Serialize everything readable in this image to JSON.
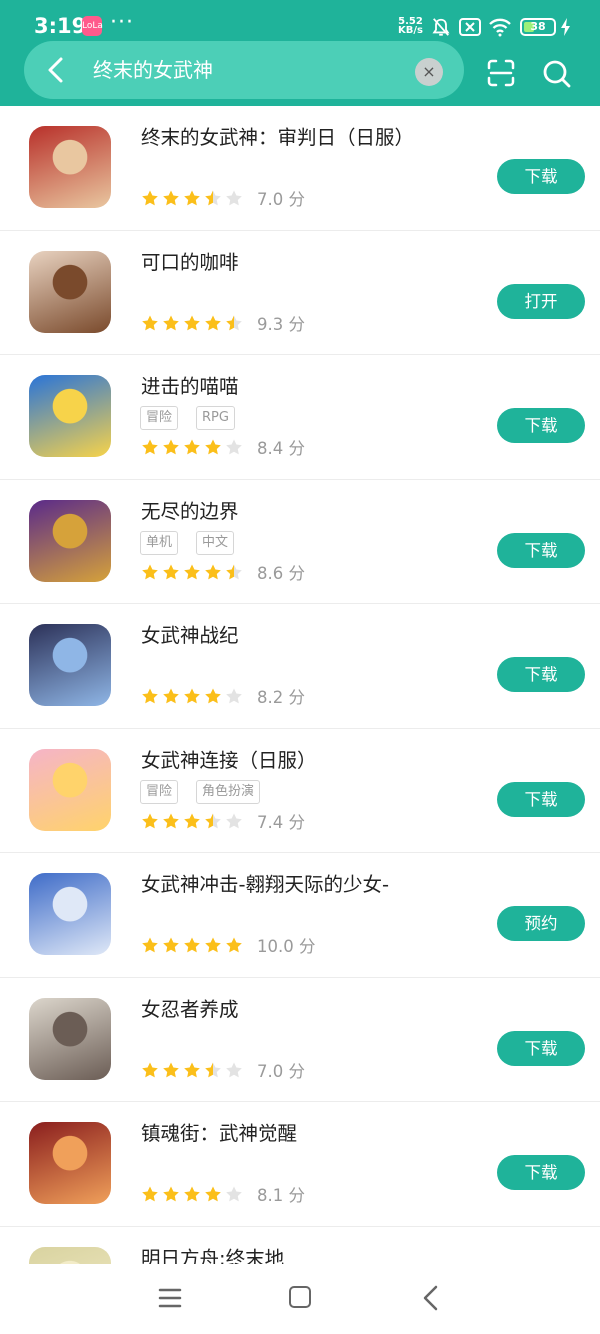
{
  "status": {
    "time": "3:19",
    "app_badge": "LoLa",
    "more": "···",
    "net_speed_value": "5.52",
    "net_speed_unit": "KB/s",
    "battery": "38"
  },
  "search": {
    "query": "终末的女武神",
    "clear_label": "×"
  },
  "colors": {
    "accent": "#1fb39a",
    "star_filled": "#fbbf1a",
    "star_empty": "#e3e3e3"
  },
  "apps": [
    {
      "name": "终末的女武神：审判日（日服）",
      "tags": [],
      "rating": 3.5,
      "score": "7.0 分",
      "action": "下载"
    },
    {
      "name": "可口的咖啡",
      "tags": [],
      "rating": 4.5,
      "score": "9.3 分",
      "action": "打开"
    },
    {
      "name": "进击的喵喵",
      "tags": [
        "冒险",
        "RPG"
      ],
      "rating": 4,
      "score": "8.4 分",
      "action": "下载"
    },
    {
      "name": "无尽的边界",
      "tags": [
        "单机",
        "中文"
      ],
      "rating": 4.5,
      "score": "8.6 分",
      "action": "下载"
    },
    {
      "name": "女武神战纪",
      "tags": [],
      "rating": 4,
      "score": "8.2 分",
      "action": "下载"
    },
    {
      "name": "女武神连接（日服）",
      "tags": [
        "冒险",
        "角色扮演"
      ],
      "rating": 3.5,
      "score": "7.4 分",
      "action": "下载"
    },
    {
      "name": "女武神冲击-翱翔天际的少女-",
      "tags": [],
      "rating": 5,
      "score": "10.0 分",
      "action": "预约"
    },
    {
      "name": "女忍者养成",
      "tags": [],
      "rating": 3.5,
      "score": "7.0 分",
      "action": "下载"
    },
    {
      "name": "镇魂街：武神觉醒",
      "tags": [],
      "rating": 4,
      "score": "8.1 分",
      "action": "下载"
    },
    {
      "name": "明日方舟:终末地",
      "tags": [],
      "rating": 0,
      "score": "",
      "action": ""
    }
  ]
}
